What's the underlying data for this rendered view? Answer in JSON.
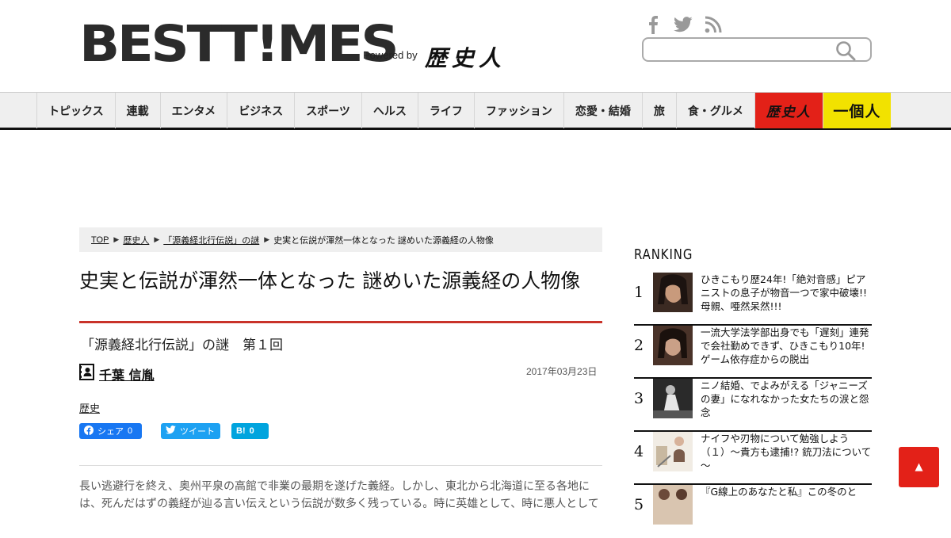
{
  "header": {
    "logo": "BESTT!MES",
    "powered_by": "Powered by",
    "partner_logo": "歴史人",
    "search_placeholder": "",
    "social_icons": [
      "facebook-icon",
      "twitter-icon",
      "rss-icon"
    ]
  },
  "nav": {
    "items": [
      "トピックス",
      "連載",
      "エンタメ",
      "ビジネス",
      "スポーツ",
      "ヘルス",
      "ライフ",
      "ファッション",
      "恋愛・結婚",
      "旅",
      "食・グルメ"
    ],
    "rekishi_label": "歴史人",
    "ikkojin_label": "一個人",
    "colors": {
      "rekishi": "#e32118",
      "ikkojin": "#f2e200"
    }
  },
  "breadcrumb": {
    "items": [
      "TOP",
      "歴史人",
      "「源義経北行伝説」の謎"
    ],
    "current": "史実と伝説が渾然一体となった 謎めいた源義経の人物像"
  },
  "article": {
    "title": "史実と伝説が渾然一体となった 謎めいた源義経の人物像",
    "subtitle": "「源義経北行伝説」の謎　第１回",
    "author": "千葉 信胤",
    "date": "2017年03月23日",
    "tag": "歴史",
    "share": {
      "facebook": "シェア",
      "facebook_count": "0",
      "twitter": "ツイート",
      "hatena": "B!",
      "hatena_count": "0"
    },
    "body": "長い逃避行を終え、奥州平泉の高館で非業の最期を遂げた義経。しかし、東北から北海道に至る各地には、死んだはずの義経が辿る言い伝えという伝説が数多く残っている。時に英雄として、時に悪人として"
  },
  "ranking": {
    "title": "RANKING",
    "items": [
      {
        "rank": "1",
        "text": "ひきこもり歴24年!「絶対音感」ピアニストの息子が物音一つで家中破壊!!　母親、唖然呆然!!!"
      },
      {
        "rank": "2",
        "text": "一流大学法学部出身でも「遅刻」連発で会社勤めできず、ひきこもり10年!　ゲーム依存症からの脱出"
      },
      {
        "rank": "3",
        "text": "ニノ結婚、でよみがえる「ジャニーズの妻」になれなかった女たちの涙と怨念"
      },
      {
        "rank": "4",
        "text": "ナイフや刃物について勉強しよう（１）～貴方も逮捕!? 銃刀法について～"
      },
      {
        "rank": "5",
        "text": "『G線上のあなたと私』この冬のと"
      }
    ]
  },
  "to_top_label": "▲"
}
